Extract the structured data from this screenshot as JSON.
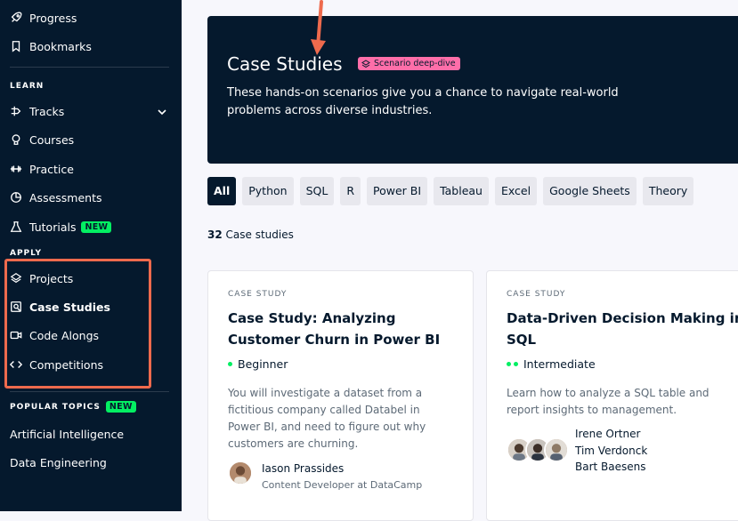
{
  "sidebar": {
    "top_items": [
      {
        "label": "Progress",
        "icon": "rocket-icon"
      },
      {
        "label": "Bookmarks",
        "icon": "bookmark-icon"
      }
    ],
    "learn_label": "LEARN",
    "learn_items": [
      {
        "label": "Tracks",
        "icon": "tracks-icon"
      },
      {
        "label": "Courses",
        "icon": "lightbulb-icon"
      },
      {
        "label": "Practice",
        "icon": "dumbbell-icon"
      },
      {
        "label": "Assessments",
        "icon": "assessment-icon"
      },
      {
        "label": "Tutorials",
        "icon": "flask-icon",
        "badge": "NEW"
      }
    ],
    "apply_label": "APPLY",
    "apply_items": [
      {
        "label": "Projects",
        "icon": "layers-icon"
      },
      {
        "label": "Case Studies",
        "icon": "case-study-icon",
        "active": true
      },
      {
        "label": "Code Alongs",
        "icon": "video-icon"
      },
      {
        "label": "Competitions",
        "icon": "code-icon"
      }
    ],
    "popular_label": "POPULAR TOPICS",
    "popular_badge": "NEW",
    "popular_items": [
      "Artificial Intelligence",
      "Data Engineering"
    ]
  },
  "hero": {
    "title": "Case Studies",
    "tag": "Scenario deep-dive",
    "description": "These hands-on scenarios give you a chance to navigate real-world problems across diverse industries."
  },
  "filters": [
    "All",
    "Python",
    "SQL",
    "R",
    "Power BI",
    "Tableau",
    "Excel",
    "Google Sheets",
    "Theory"
  ],
  "active_filter": "All",
  "count": {
    "number": "32",
    "label": "Case studies"
  },
  "cards": [
    {
      "eyebrow": "CASE STUDY",
      "title": "Case Study: Analyzing Customer Churn in Power BI",
      "level": "Beginner",
      "level_dots": 1,
      "description": "You will investigate a dataset from a fictitious company called Databel in Power BI, and need to figure out why customers are churning.",
      "authors": [
        "Iason Prassides"
      ],
      "author_role": "Content Developer at DataCamp"
    },
    {
      "eyebrow": "CASE STUDY",
      "title": "Data-Driven Decision Making in SQL",
      "level": "Intermediate",
      "level_dots": 2,
      "description": "Learn how to analyze a SQL table and report insights to management.",
      "authors": [
        "Irene Ortner",
        "Tim Verdonck",
        "Bart Baesens"
      ]
    }
  ],
  "colors": {
    "sidebar_bg": "#05192d",
    "accent_green": "#03ef62",
    "annotation_red": "#ee6a4d",
    "tag_pink": "#ff6ea9"
  }
}
